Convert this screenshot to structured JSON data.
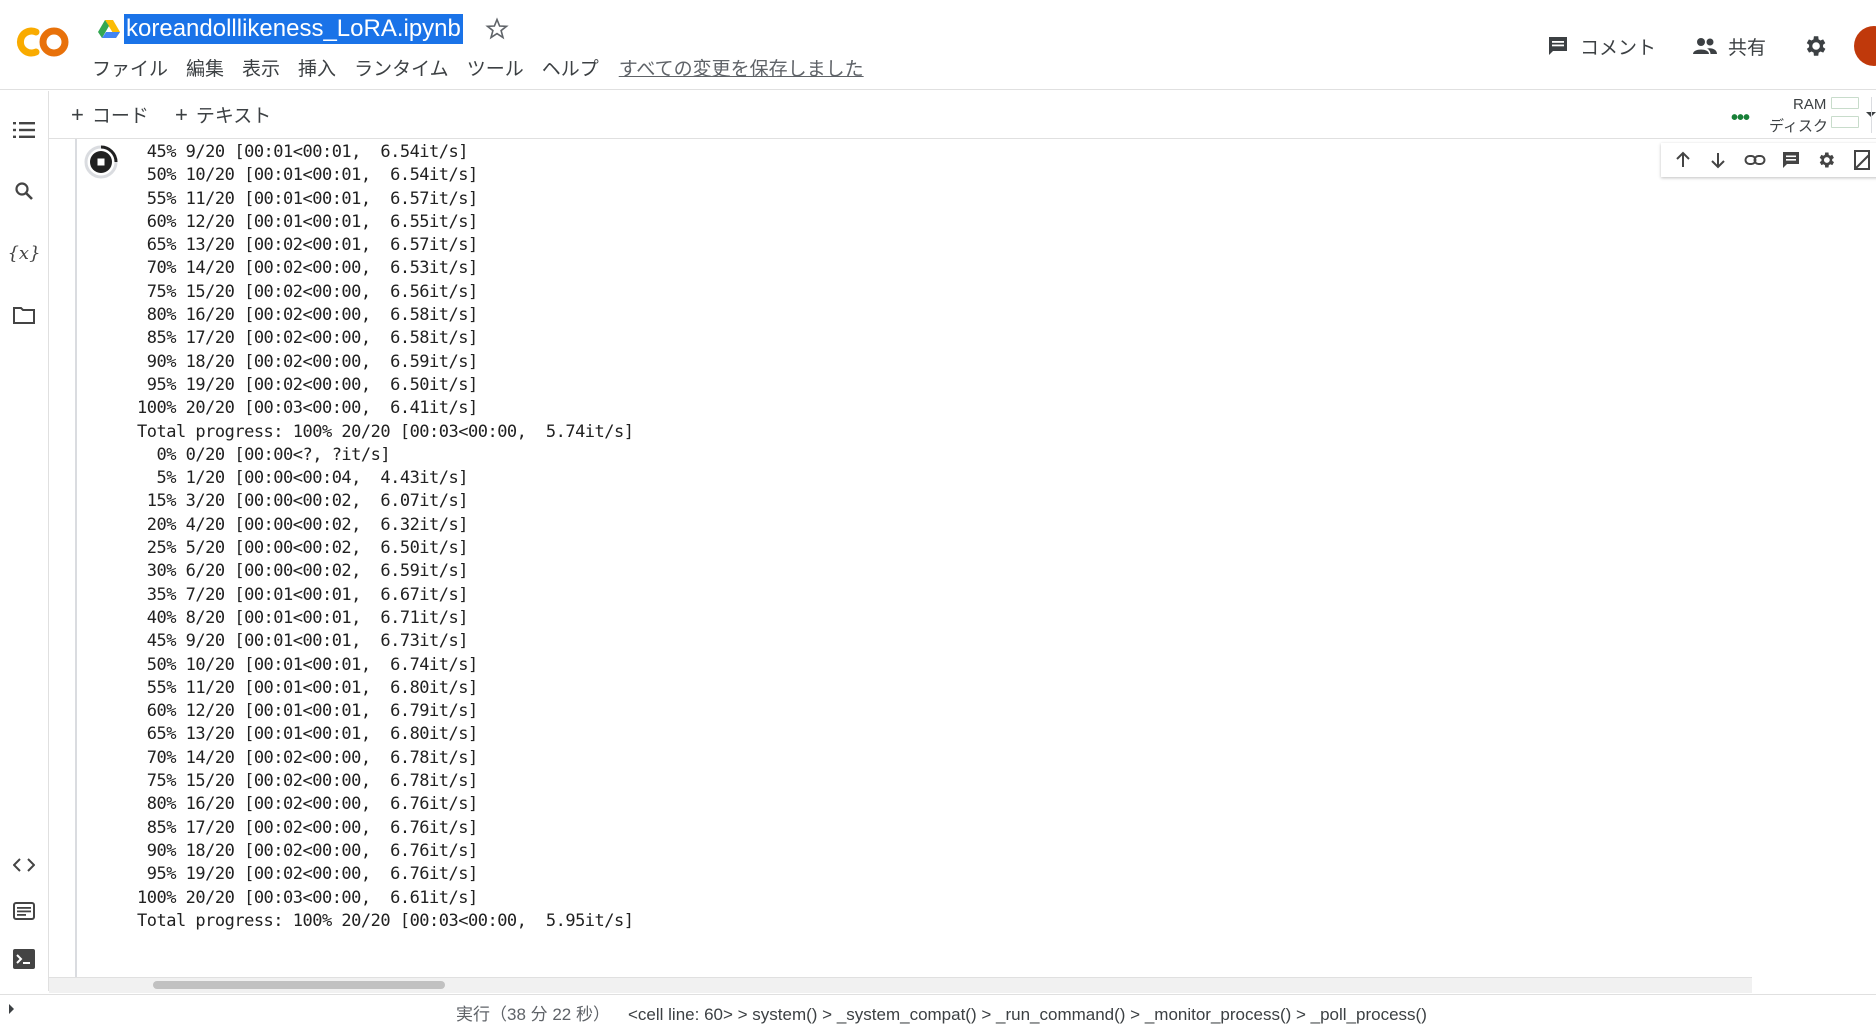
{
  "header": {
    "notebook_title": "koreandolllikeness_LoRA.ipynb",
    "menu": [
      "ファイル",
      "編集",
      "表示",
      "挿入",
      "ランタイム",
      "ツール",
      "ヘルプ"
    ],
    "save_status": "すべての変更を保存しました",
    "comment_label": "コメント",
    "share_label": "共有"
  },
  "toolbar": {
    "add_code": "コード",
    "add_text": "テキスト",
    "ram_label": "RAM",
    "disk_label": "ディスク"
  },
  "colors": {
    "accent": "#1a73e8",
    "logo_orange": "#f9ab00",
    "logo_dark_orange": "#e8710a",
    "avatar": "#c0390b",
    "connected_green": "#188038"
  },
  "output_lines": [
    " 45% 9/20 [00:01<00:01,  6.54it/s]",
    " 50% 10/20 [00:01<00:01,  6.54it/s]",
    " 55% 11/20 [00:01<00:01,  6.57it/s]",
    " 60% 12/20 [00:01<00:01,  6.55it/s]",
    " 65% 13/20 [00:02<00:01,  6.57it/s]",
    " 70% 14/20 [00:02<00:00,  6.53it/s]",
    " 75% 15/20 [00:02<00:00,  6.56it/s]",
    " 80% 16/20 [00:02<00:00,  6.58it/s]",
    " 85% 17/20 [00:02<00:00,  6.58it/s]",
    " 90% 18/20 [00:02<00:00,  6.59it/s]",
    " 95% 19/20 [00:02<00:00,  6.50it/s]",
    "100% 20/20 [00:03<00:00,  6.41it/s]",
    "Total progress: 100% 20/20 [00:03<00:00,  5.74it/s]",
    "  0% 0/20 [00:00<?, ?it/s]",
    "  5% 1/20 [00:00<00:04,  4.43it/s]",
    " 15% 3/20 [00:00<00:02,  6.07it/s]",
    " 20% 4/20 [00:00<00:02,  6.32it/s]",
    " 25% 5/20 [00:00<00:02,  6.50it/s]",
    " 30% 6/20 [00:00<00:02,  6.59it/s]",
    " 35% 7/20 [00:01<00:01,  6.67it/s]",
    " 40% 8/20 [00:01<00:01,  6.71it/s]",
    " 45% 9/20 [00:01<00:01,  6.73it/s]",
    " 50% 10/20 [00:01<00:01,  6.74it/s]",
    " 55% 11/20 [00:01<00:01,  6.80it/s]",
    " 60% 12/20 [00:01<00:01,  6.79it/s]",
    " 65% 13/20 [00:01<00:01,  6.80it/s]",
    " 70% 14/20 [00:02<00:00,  6.78it/s]",
    " 75% 15/20 [00:02<00:00,  6.78it/s]",
    " 80% 16/20 [00:02<00:00,  6.76it/s]",
    " 85% 17/20 [00:02<00:00,  6.76it/s]",
    " 90% 18/20 [00:02<00:00,  6.76it/s]",
    " 95% 19/20 [00:02<00:00,  6.76it/s]",
    "100% 20/20 [00:03<00:00,  6.61it/s]",
    "Total progress: 100% 20/20 [00:03<00:00,  5.95it/s]"
  ],
  "statusbar": {
    "exec_label": "実行（38 分 22 秒）",
    "trace": "<cell line: 60> > system() > _system_compat() > _run_command() > _monitor_process() > _poll_process()"
  },
  "icons": {
    "rail": [
      "toc-icon",
      "search-icon",
      "variables-icon",
      "folder-icon",
      "code-snippets-icon",
      "command-palette-icon",
      "terminal-icon"
    ],
    "cell_toolbar": [
      "move-up-icon",
      "move-down-icon",
      "link-icon",
      "comment-icon",
      "settings-icon",
      "mirror-cell-icon",
      "delete-icon"
    ]
  }
}
